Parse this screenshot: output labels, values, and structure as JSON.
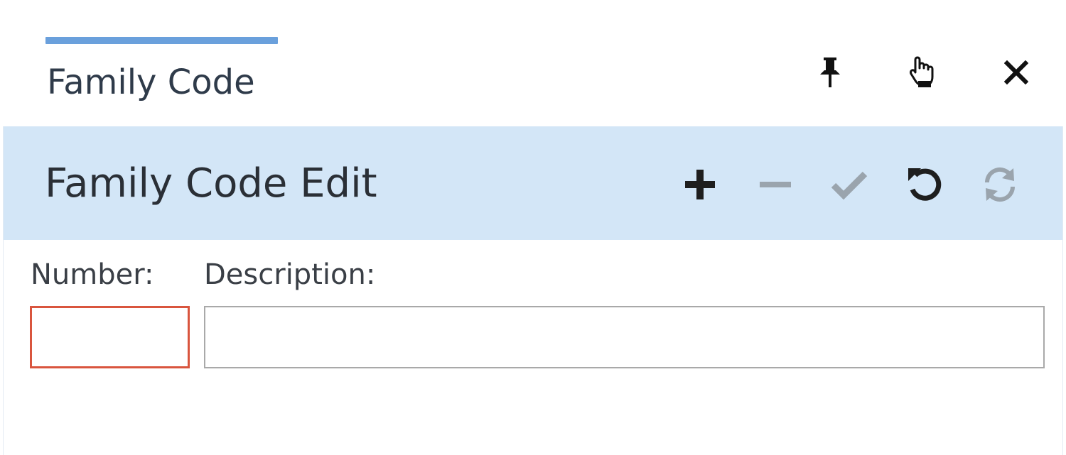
{
  "tab": {
    "title": "Family Code",
    "accent_color": "#6aa0dc"
  },
  "window_controls": {
    "pin_icon": "pin-icon",
    "pointer_icon": "hand-pointer-icon",
    "close_icon": "close-icon"
  },
  "panel": {
    "title": "Family Code Edit",
    "header_color": "#d3e6f7",
    "toolbar": [
      {
        "icon": "plus-icon",
        "enabled": true
      },
      {
        "icon": "minus-icon",
        "enabled": false
      },
      {
        "icon": "check-icon",
        "enabled": false
      },
      {
        "icon": "undo-icon",
        "enabled": true
      },
      {
        "icon": "refresh-icon",
        "enabled": false
      }
    ]
  },
  "form": {
    "number": {
      "label": "Number:",
      "value": "",
      "invalid": true,
      "error_color": "#d9553e"
    },
    "description": {
      "label": "Description:",
      "value": ""
    }
  }
}
